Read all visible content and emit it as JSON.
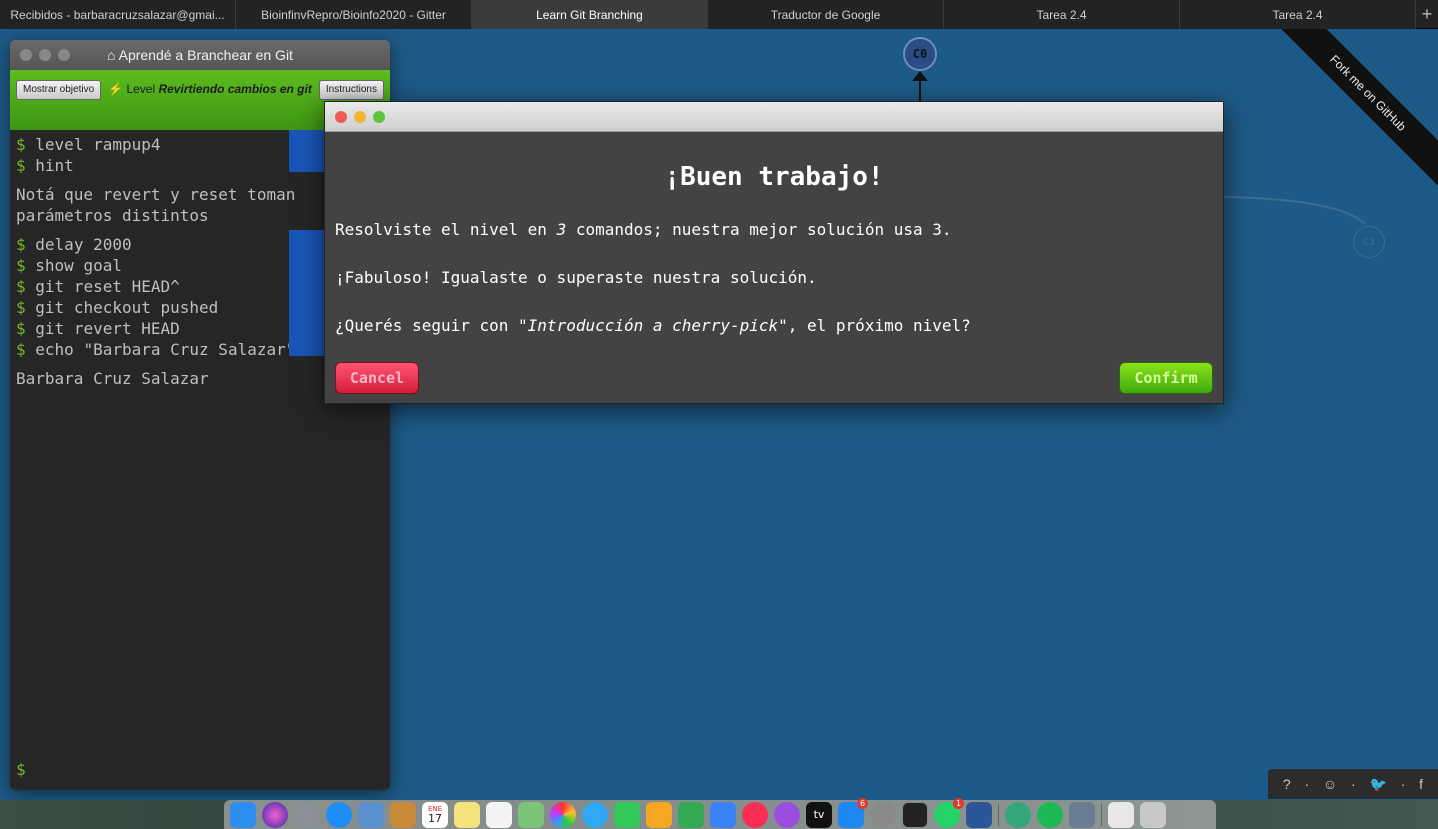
{
  "browser": {
    "tabs": [
      {
        "label": "Recibidos - barbaracruzsalazar@gmai..."
      },
      {
        "label": "BioinfinvRepro/Bioinfo2020 - Gitter"
      },
      {
        "label": "Learn Git Branching"
      },
      {
        "label": "Traductor de Google"
      },
      {
        "label": "Tarea 2.4"
      },
      {
        "label": "Tarea 2.4"
      }
    ],
    "new_tab": "+"
  },
  "canvas": {
    "commit_main": "C0",
    "commit_faint": "C3",
    "ribbon": "Fork me on GitHub"
  },
  "terminal": {
    "title": "Aprendé a Branchear en Git",
    "goal_button": "Mostrar objetivo",
    "level_prefix": "Level",
    "level_name": "Revirtiendo cambios en git",
    "instructions_button": "Instructions",
    "lines": [
      {
        "dollar": "$",
        "text": "level rampup4"
      },
      {
        "dollar": "$",
        "text": "hint"
      },
      {
        "output": "Notá que revert y reset toman parámetros distintos"
      },
      {
        "dollar": "$",
        "text": "delay 2000"
      },
      {
        "dollar": "$",
        "text": "show goal"
      },
      {
        "dollar": "$",
        "text": "git reset HEAD^"
      },
      {
        "dollar": "$",
        "text": "git checkout pushed"
      },
      {
        "dollar": "$",
        "text": "git revert HEAD"
      },
      {
        "dollar": "$",
        "text": "echo \"Barbara Cruz Salazar\""
      },
      {
        "output": "Barbara Cruz Salazar"
      }
    ],
    "prompt": "$"
  },
  "modal": {
    "heading": "¡Buen trabajo!",
    "line1_a": "Resolviste el nivel en ",
    "line1_count": "3",
    "line1_b": " comandos; nuestra mejor solución usa 3.",
    "line2": "¡Fabuloso! Igualaste o superaste nuestra solución.",
    "line3_a": "¿Querés seguir con ",
    "line3_level": "\"Introducción a cherry-pick\"",
    "line3_b": ", el próximo nivel?",
    "cancel": "Cancel",
    "confirm": "Confirm"
  },
  "help": {
    "items": [
      "?",
      "·",
      "☺",
      "·",
      "🐦",
      "·",
      "f"
    ]
  },
  "dock": {
    "calendar_month": "ENE",
    "calendar_day": "17",
    "appstore_badge": "6",
    "whatsapp_badge": "1",
    "appletv_label": "tv"
  }
}
